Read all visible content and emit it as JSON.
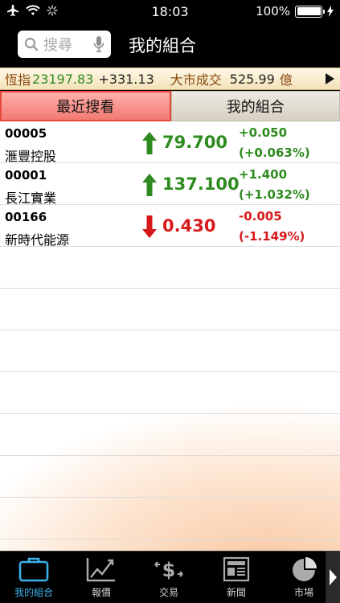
{
  "status_bar": {
    "time": "18:03",
    "battery": "100%"
  },
  "nav": {
    "search_placeholder": "搜尋",
    "title": "我的組合"
  },
  "ticker": {
    "index_label": "恆指",
    "index_value": "23197.83",
    "index_change": "+331.13",
    "turnover_label": "大市成交",
    "turnover_value": "525.99",
    "turnover_unit": "億"
  },
  "tabs": [
    {
      "label": "最近搜看"
    },
    {
      "label": "我的組合"
    }
  ],
  "stocks": [
    {
      "code": "00005",
      "name": "滙豐控股",
      "price": "79.700",
      "change": "+0.050",
      "pct": "(+0.063%)",
      "direction": "up"
    },
    {
      "code": "00001",
      "name": "長江實業",
      "price": "137.100",
      "change": "+1.400",
      "pct": "(+1.032%)",
      "direction": "up"
    },
    {
      "code": "00166",
      "name": "新時代能源",
      "price": "0.430",
      "change": "-0.005",
      "pct": "(-1.149%)",
      "direction": "down"
    }
  ],
  "tab_bar": [
    {
      "label": "我的組合",
      "icon": "briefcase-icon",
      "active": true
    },
    {
      "label": "報價",
      "icon": "chart-icon",
      "active": false
    },
    {
      "label": "交易",
      "icon": "dollar-arrows-icon",
      "active": false
    },
    {
      "label": "新聞",
      "icon": "newspaper-icon",
      "active": false
    },
    {
      "label": "市場",
      "icon": "pie-chart-icon",
      "active": false
    }
  ],
  "colors": {
    "up": "#2e8b1f",
    "down": "#d7191b",
    "accent": "#3cb0e8",
    "tab_active": "#f27a72"
  }
}
